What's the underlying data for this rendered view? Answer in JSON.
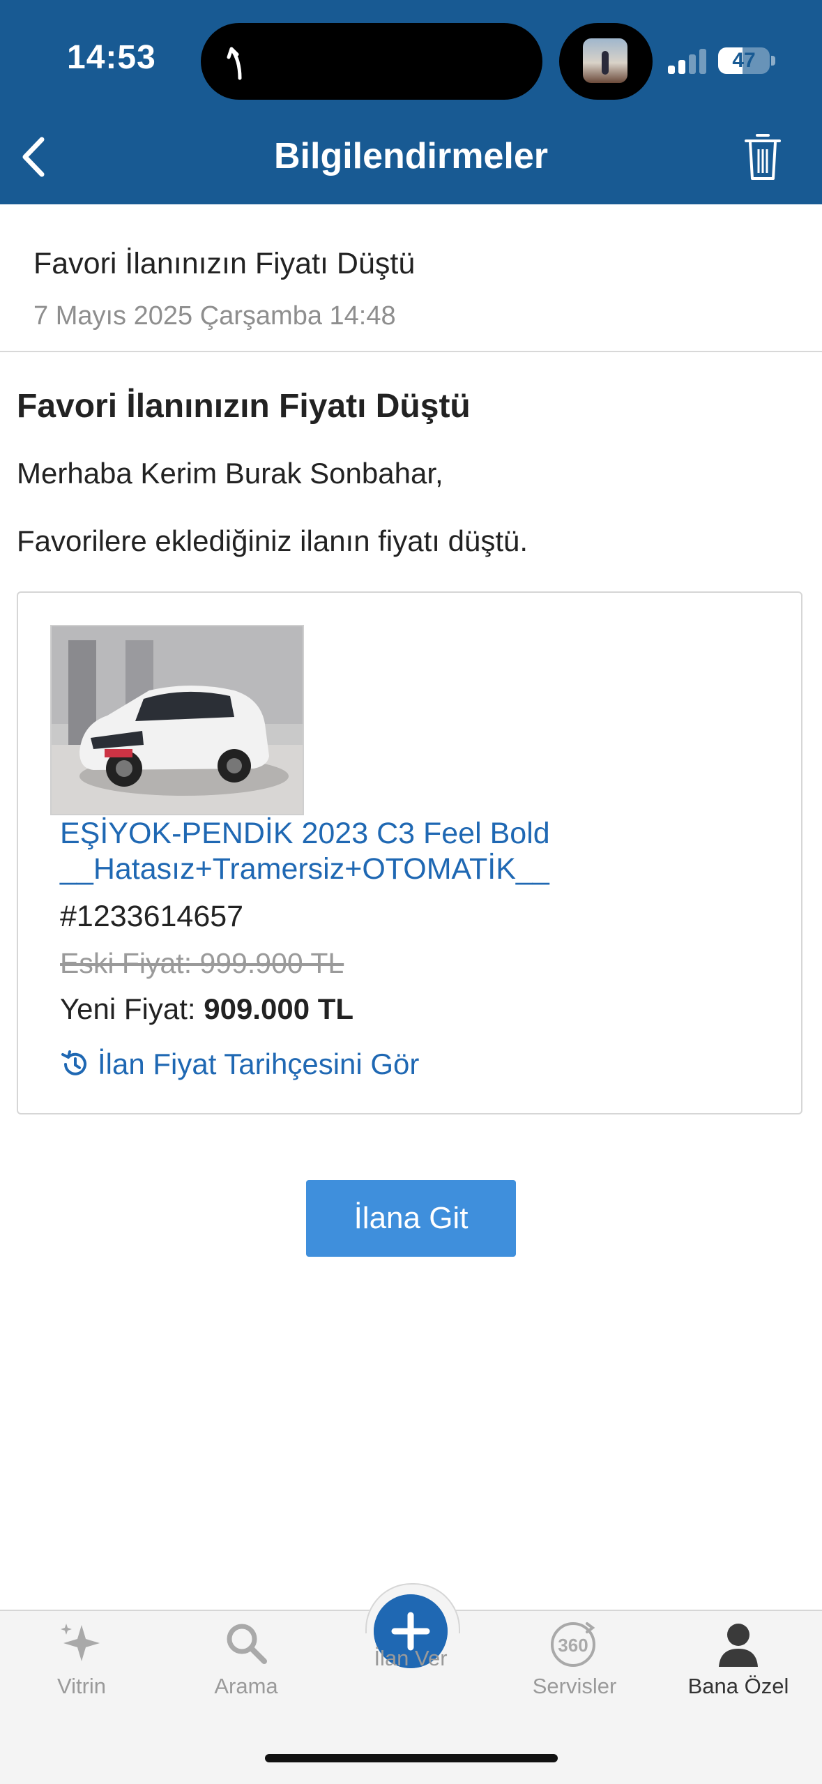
{
  "status_bar": {
    "time": "14:53",
    "battery": "47",
    "battery_level": 0.47
  },
  "nav": {
    "title": "Bilgilendirmeler",
    "back_icon": "chevron-left-icon",
    "trash_icon": "trash-icon"
  },
  "notification": {
    "title": "Favori İlanınızın Fiyatı Düştü",
    "date": "7 Mayıs 2025 Çarşamba 14:48"
  },
  "content": {
    "heading": "Favori İlanınızın Fiyatı Düştü",
    "greeting": "Merhaba Kerim Burak Sonbahar,",
    "message": "Favorilere eklediğiniz ilanın fiyatı düştü."
  },
  "listing": {
    "title_line1": "EŞİYOK-PENDİK 2023 C3 Feel Bold",
    "title_line2": "__Hatasız+Tramersiz+OTOMATİK__",
    "id": "#1233614657",
    "old_price": "Eski Fiyat: 999.900 TL",
    "new_price_label": "Yeni Fiyat: ",
    "new_price_value": "909.000 TL",
    "history_link": "İlan Fiyat Tarihçesini Gör"
  },
  "actions": {
    "go_button": "İlana Git"
  },
  "tabs": [
    {
      "label": "Vitrin",
      "icon": "sparkle-icon"
    },
    {
      "label": "Arama",
      "icon": "search-icon"
    },
    {
      "label": "İlan Ver",
      "icon": "plus-icon"
    },
    {
      "label": "Servisler",
      "icon": "360-icon"
    },
    {
      "label": "Bana Özel",
      "icon": "person-icon",
      "active": true
    }
  ],
  "colors": {
    "header": "#185a93",
    "link": "#1f68b3",
    "button": "#3f8fdc"
  }
}
